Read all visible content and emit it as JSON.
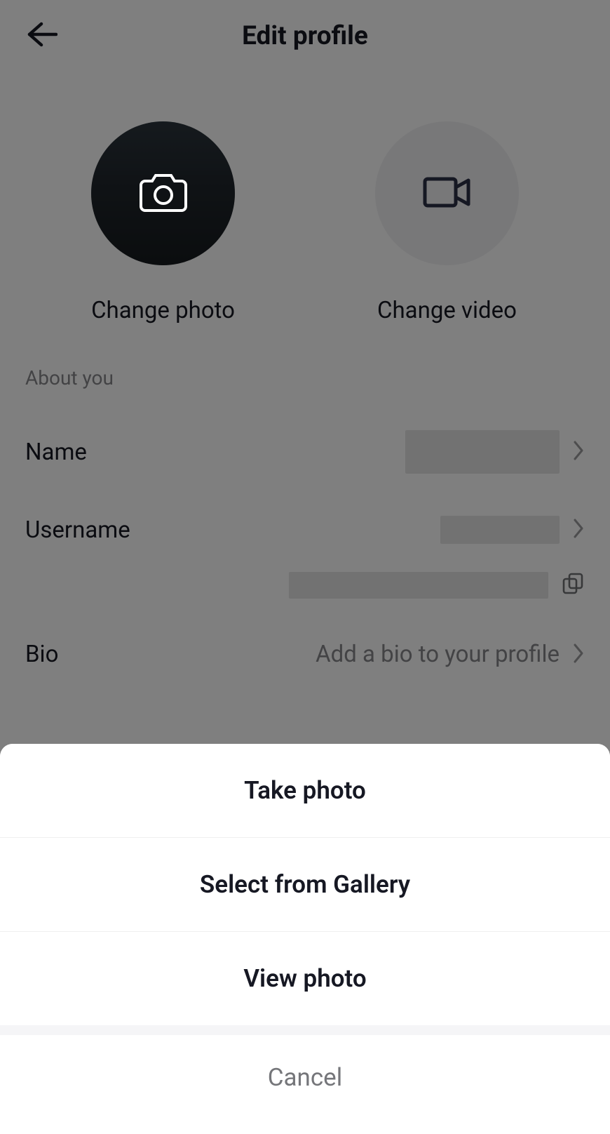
{
  "header": {
    "title": "Edit profile"
  },
  "media": {
    "change_photo_label": "Change photo",
    "change_video_label": "Change video"
  },
  "about": {
    "section_label": "About you",
    "name_label": "Name",
    "username_label": "Username",
    "bio_label": "Bio",
    "bio_placeholder": "Add a bio to your profile"
  },
  "sheet": {
    "take_photo": "Take photo",
    "select_gallery": "Select from Gallery",
    "view_photo": "View photo",
    "cancel": "Cancel"
  }
}
